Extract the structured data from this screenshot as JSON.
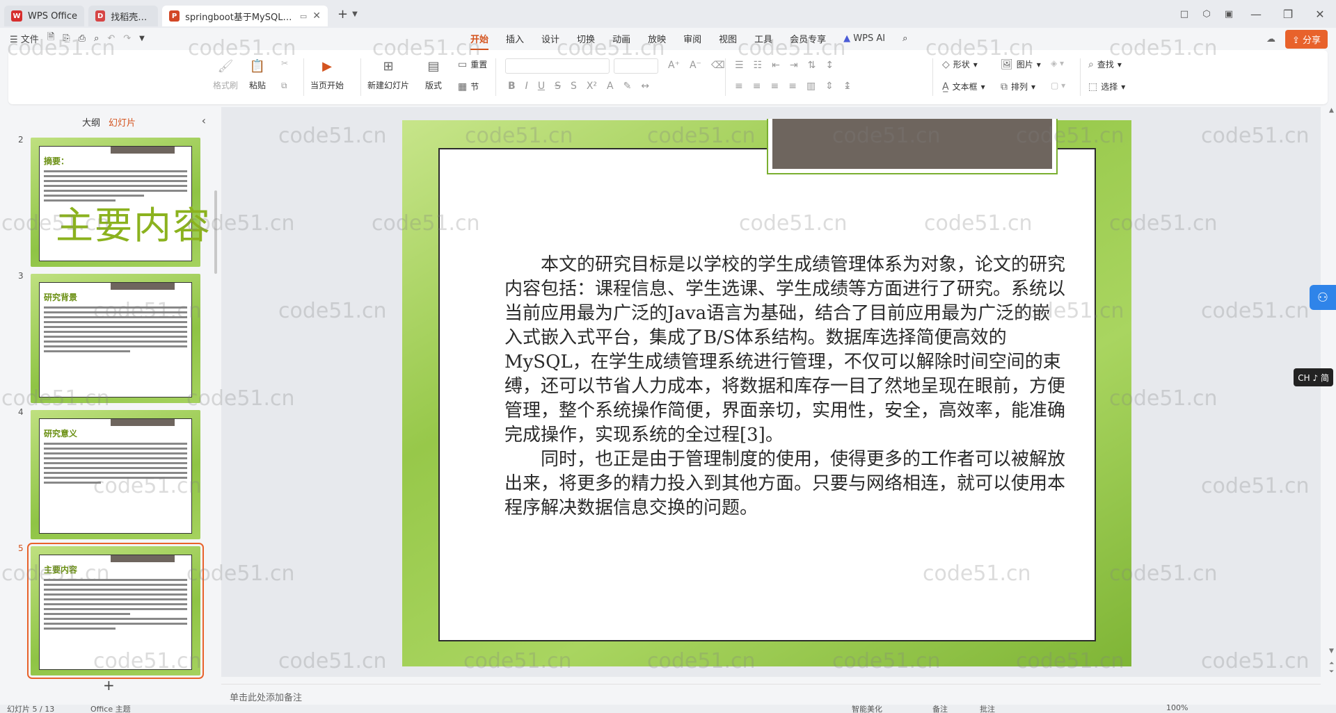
{
  "titlebar": {
    "tabs": [
      {
        "label": "WPS Office",
        "icon": "wps-logo-icon",
        "color": "#d62e2e"
      },
      {
        "label": "找稻壳模板",
        "icon": "docer-icon",
        "color": "#d64545"
      },
      {
        "label": "springboot基于MySQL的学",
        "icon": "ppt-icon",
        "color": "#d24726"
      }
    ],
    "new_tab": "+",
    "window_buttons": [
      "□",
      "⬡",
      "▣",
      "—",
      "❐",
      "✕"
    ]
  },
  "menubar": {
    "file": "文件",
    "items": [
      "开始",
      "插入",
      "设计",
      "切换",
      "动画",
      "放映",
      "审阅",
      "视图",
      "工具",
      "会员专享"
    ],
    "active": "开始",
    "ai": "WPS AI",
    "share": "分享"
  },
  "ribbon": {
    "format_painter": "格式刷",
    "paste": "粘贴",
    "play_from_current": "当页开始",
    "new_slide": "新建幻灯片",
    "layout": "版式",
    "reset": "重置",
    "section": "节",
    "shape": "形状",
    "picture": "图片",
    "textbox": "文本框",
    "arrange": "排列",
    "find": "查找",
    "select": "选择",
    "format_buttons": [
      "B",
      "I",
      "U",
      "S",
      "S",
      "X²"
    ]
  },
  "left_panel": {
    "tab_outline": "大纲",
    "tab_slides": "幻灯片",
    "add_slide": "+",
    "thumbnails": [
      {
        "num": "2",
        "title": "摘要："
      },
      {
        "num": "3",
        "title": "研究背景"
      },
      {
        "num": "4",
        "title": "研究意义"
      },
      {
        "num": "5",
        "title": "主要内容"
      }
    ]
  },
  "slide": {
    "title": "主要内容",
    "paragraphs": [
      "本文的研究目标是以学校的学生成绩管理体系为对象，论文的研究内容包括：课程信息、学生选课、学生成绩等方面进行了研究。系统以当前应用最为广泛的Java语言为基础，结合了目前应用最为广泛的嵌入式嵌入式平台，集成了B/S体系结构。数据库选择简便高效的MySQL，在学生成绩管理系统进行管理，不仅可以解除时间空间的束缚，还可以节省人力成本，将数据和库存一目了然地呈现在眼前，方便管理，整个系统操作简便，界面亲切，实用性，安全，高效率，能准确完成操作，实现系统的全过程[3]。",
      "同时，也正是由于管理制度的使用，使得更多的工作者可以被解放出来，将更多的精力投入到其他方面。只要与网络相连，就可以使用本程序解决数据信息交换的问题。"
    ]
  },
  "notes": {
    "placeholder": "单击此处添加备注"
  },
  "statusbar": {
    "slide_info": "幻灯片 5 / 13",
    "theme": "Office 主题",
    "smart": "智能美化",
    "notes": "备注",
    "comment": "批注",
    "zoom": "100%"
  },
  "widgets": {
    "ime": "CH ♪ 简"
  },
  "watermark": "code51.cn",
  "colors": {
    "accent": "#d4541f",
    "share": "#e8622b",
    "slide_green": "#97c84a",
    "title_green": "#8bb21e"
  }
}
